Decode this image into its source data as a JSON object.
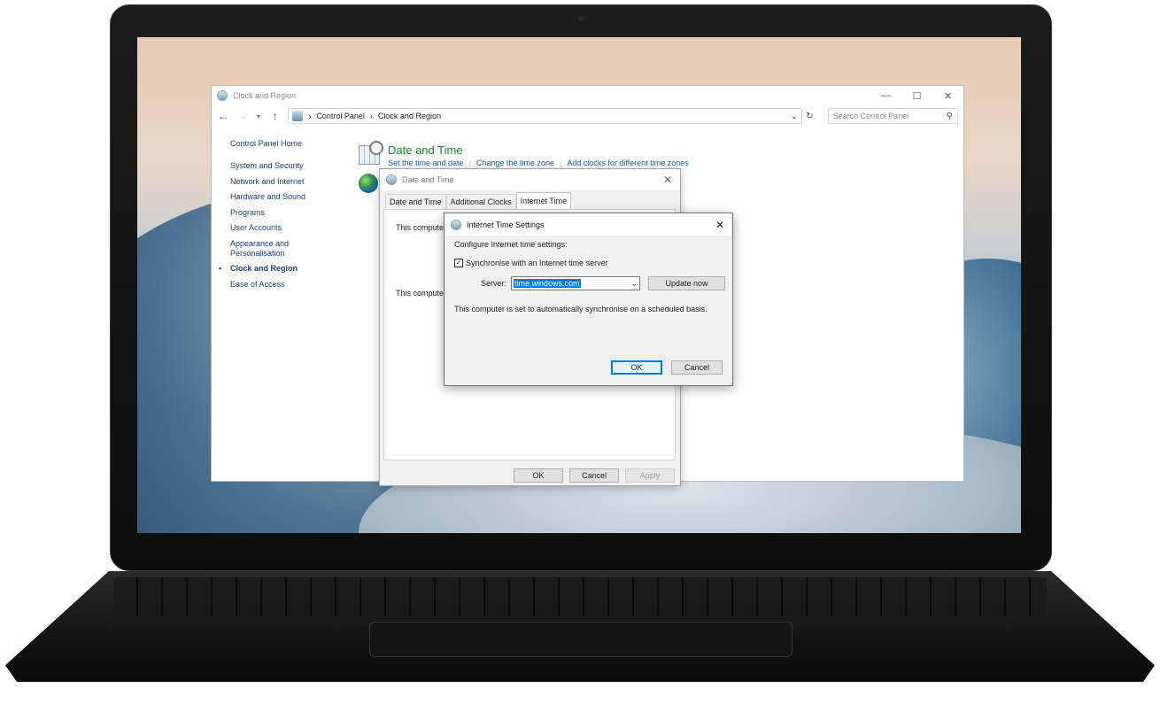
{
  "control_panel": {
    "window_title": "Clock and Region",
    "win_minimize": "—",
    "win_maximize": "☐",
    "win_close": "✕",
    "breadcrumb": [
      "Control Panel",
      "Clock and Region"
    ],
    "breadcrumb_sep": "›",
    "search_placeholder": "Search Control Panel",
    "sidebar": {
      "home": "Control Panel Home",
      "items": [
        "System and Security",
        "Network and Internet",
        "Hardware and Sound",
        "Programs",
        "User Accounts",
        "Appearance and Personalisation",
        "Clock and Region",
        "Ease of Access"
      ],
      "current_item": "Clock and Region"
    },
    "section": {
      "title": "Date and Time",
      "links": [
        "Set the time and date",
        "Change the time zone",
        "Add clocks for different time zones"
      ]
    }
  },
  "date_time_dialog": {
    "title": "Date and Time",
    "tabs": [
      "Date and Time",
      "Additional Clocks",
      "Internet Time"
    ],
    "active_tab": "Internet Time",
    "panel_text_1": "This compute",
    "panel_text_2": "This compute",
    "buttons": {
      "ok": "OK",
      "cancel": "Cancel",
      "apply": "Apply"
    }
  },
  "internet_time_dialog": {
    "title": "Internet Time Settings",
    "heading": "Configure Internet time settings:",
    "sync_checkbox_label": "Synchronise with an Internet time server",
    "sync_checked": "✓",
    "server_label": "Server:",
    "server_value": "time.windows.com",
    "update_button": "Update now",
    "status": "This computer is set to automatically synchronise on a scheduled basis.",
    "buttons": {
      "ok": "OK",
      "cancel": "Cancel"
    }
  },
  "colors": {
    "link": "#1a5fb4",
    "section_title": "#1e7c2a",
    "selection": "#0078d7"
  }
}
